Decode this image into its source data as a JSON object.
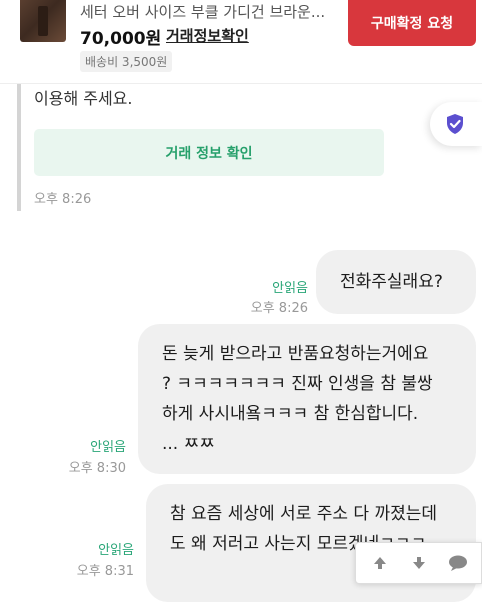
{
  "product": {
    "title": "세터 오버 사이즈 부클 가디건 브라운...",
    "price": "70,000원",
    "trade_info_link": "거래정보확인",
    "shipping": "배송비 3,500원",
    "buy_button": "구매확정 요청"
  },
  "system_message": {
    "text": "이용해 주세요.",
    "button": "거래 정보 확인",
    "time": "오후 8:26"
  },
  "messages": [
    {
      "text": "전화주실래요?",
      "status": "안읽음",
      "time": "오후 8:26"
    },
    {
      "lines": [
        "돈 늦게 받으라고 반품요청하는거에요",
        "? ㅋㅋㅋㅋㅋㅋㅋ 진짜 인생을 참 불쌍",
        "하게 사시내욬ㅋㅋㅋ 참 한심합니다.",
        "... ㅉㅉ"
      ],
      "status": "안읽음",
      "time": "오후 8:30"
    },
    {
      "lines": [
        "참 요즘 세상에 서로 주소 다 까졌는데",
        "도 왜 저러고 사는지 모르겠네ㅋㅋㅋ"
      ],
      "status": "안읽음",
      "time": "오후 8:31"
    }
  ],
  "icons": {
    "shield": "shield-check-icon",
    "up": "arrow-up-icon",
    "down": "arrow-down-icon",
    "comment": "comment-icon"
  },
  "colors": {
    "accent_red": "#d8373d",
    "accent_green": "#2aa678",
    "shield_purple": "#5b4fcf"
  }
}
